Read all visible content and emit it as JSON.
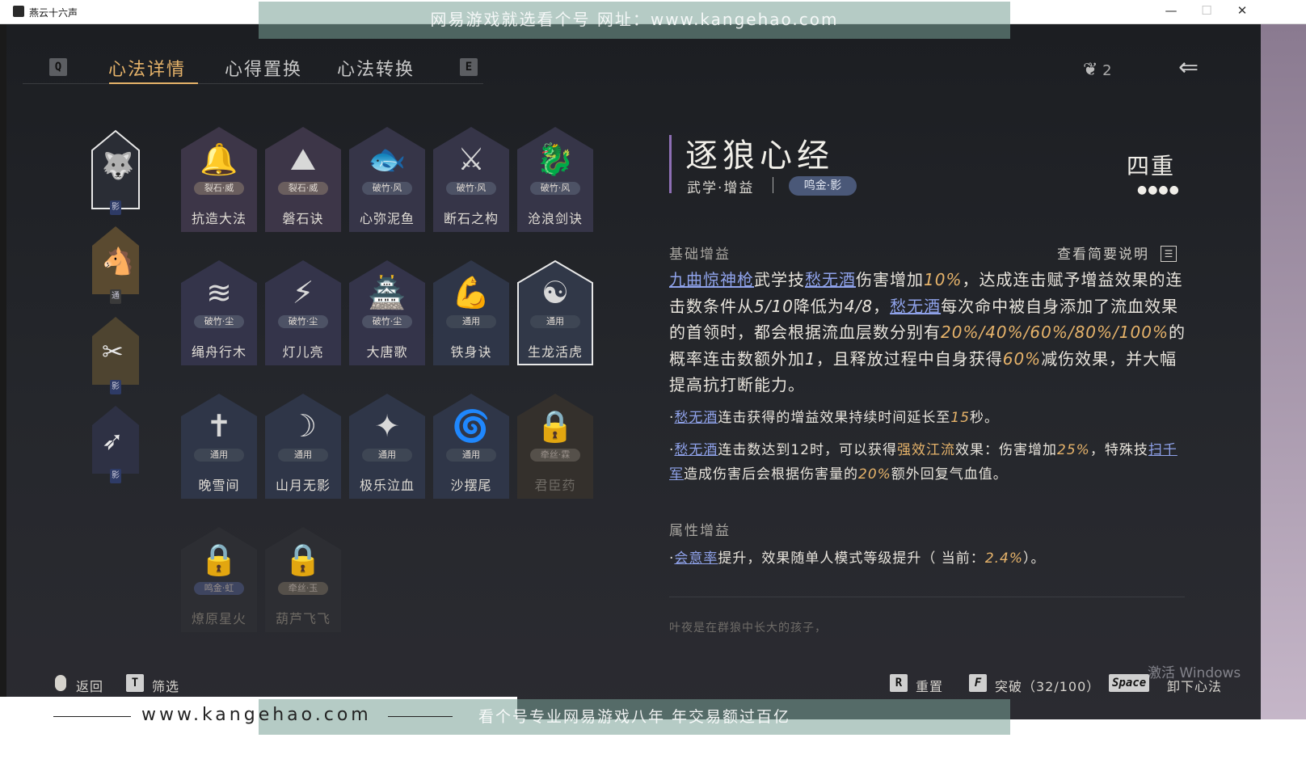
{
  "window": {
    "title": "燕云十六声",
    "min": "—",
    "max": "☐",
    "close": "✕"
  },
  "watermark": {
    "top": "网易游戏就选看个号   网址：www.kangehao.com",
    "site": "www.kangehao.com",
    "bottom": "看个号专业网易游戏八年  年交易额过百亿"
  },
  "tabs": {
    "q_key": "Q",
    "e_key": "E",
    "items": [
      "心法详情",
      "心得置换",
      "心法转换"
    ]
  },
  "header": {
    "points": "2",
    "back_icon": "back-arrow-icon"
  },
  "side": [
    {
      "tag": "影",
      "glyph": "🐺"
    },
    {
      "tag": "通",
      "glyph": "🐴"
    },
    {
      "tag": "影",
      "glyph": "✂"
    },
    {
      "tag": "影",
      "glyph": "➶"
    }
  ],
  "cards": [
    {
      "name": "抗造大法",
      "tag": "裂石·威",
      "glyph": "🔔"
    },
    {
      "name": "磐石诀",
      "tag": "裂石·威",
      "glyph": "⛰"
    },
    {
      "name": "心弥泥鱼",
      "tag": "破竹·风",
      "glyph": "🐟"
    },
    {
      "name": "断石之构",
      "tag": "破竹·风",
      "glyph": "⚔"
    },
    {
      "name": "沧浪剑诀",
      "tag": "破竹·风",
      "glyph": "🐉"
    },
    {
      "name": "绳舟行木",
      "tag": "破竹·尘",
      "glyph": "≋"
    },
    {
      "name": "灯儿亮",
      "tag": "破竹·尘",
      "glyph": "⚡"
    },
    {
      "name": "大唐歌",
      "tag": "破竹·尘",
      "glyph": "🏯"
    },
    {
      "name": "铁身诀",
      "tag": "通用",
      "glyph": "💪"
    },
    {
      "name": "生龙活虎",
      "tag": "通用",
      "glyph": "☯"
    },
    {
      "name": "晚雪间",
      "tag": "通用",
      "glyph": "✝"
    },
    {
      "name": "山月无影",
      "tag": "通用",
      "glyph": "☽"
    },
    {
      "name": "极乐泣血",
      "tag": "通用",
      "glyph": "✦"
    },
    {
      "name": "沙摆尾",
      "tag": "通用",
      "glyph": "🌀"
    },
    {
      "name": "君臣药",
      "tag": "牵丝·霖",
      "glyph": "🔒"
    },
    {
      "name": "燎原星火",
      "tag": "鸣金·虹",
      "glyph": "🔒"
    },
    {
      "name": "葫芦飞飞",
      "tag": "牵丝·玉",
      "glyph": "🔒"
    }
  ],
  "detail": {
    "title": "逐狼心经",
    "category": "武学·增益",
    "badge": "鸣金·影",
    "rank": "四重",
    "rank_dots": "●●●●",
    "base_heading": "基础增益",
    "view_summary": "查看简要说明",
    "p1": {
      "a": "九曲惊神枪",
      "b": "武学技",
      "c": "愁无酒",
      "d": "伤害增加",
      "e": "10%",
      "f": "，达成连击赋予增益效果的连击数条件从",
      "g": "5/10",
      "h": "降低为",
      "i": "4/8",
      "j": "，",
      "k": "愁无酒",
      "l": "每次命中被自身添加了流血效果的首领时，都会根据流血层数分别有",
      "m": "20%/40%/60%/80%/100%",
      "n": "的概率连击数额外加",
      "o": "1",
      "p": "，且释放过程中自身获得",
      "q": "60%",
      "r": "减伤效果，并大幅提高抗打断能力。"
    },
    "p2": {
      "a": "·",
      "b": "愁无酒",
      "c": "连击获得的增益效果持续时间延长至",
      "d": "15",
      "e": "秒。"
    },
    "p3": {
      "a": "·",
      "b": "愁无酒",
      "c": "连击数达到12时，可以获得",
      "d": "强效江流",
      "e": "效果：伤害增加",
      "f": "25%",
      "g": "，特殊技",
      "h": "扫千军",
      "i": "造成伤害后会根据伤害量的",
      "j": "20%",
      "k": "额外回复气血值。"
    },
    "attr_heading": "属性增益",
    "attr": {
      "a": "·",
      "b": "会意率",
      "c": "提升，效果随单人模式等级提升（ 当前：",
      "d": "2.4%",
      "e": "）。"
    },
    "flavor": "叶夜是在群狼中长大的孩子，"
  },
  "controls": {
    "back": "返回",
    "filter_key": "T",
    "filter": "筛选",
    "reset_key": "R",
    "reset": "重置",
    "break_key": "F",
    "break": "突破（32/100）",
    "unequip_key": "Space",
    "unequip": "卸下心法"
  },
  "os": {
    "activate": "激活 Windows"
  }
}
